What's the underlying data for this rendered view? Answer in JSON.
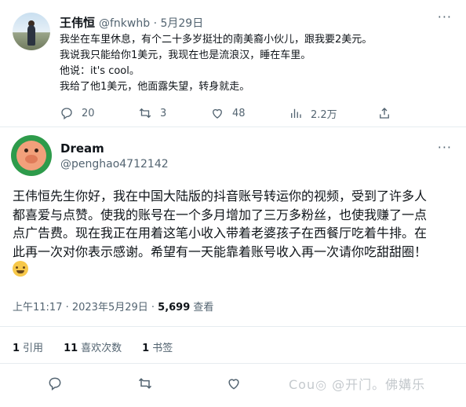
{
  "reply_tweet": {
    "author_name": "王伟恒",
    "author_handle": "@fnkwhb · 5月29日",
    "lines": [
      "我坐在车里休息，有个二十多岁挺壮的南美裔小伙儿，跟我要2美元。",
      "我说我只能给你1美元，我现在也是流浪汉，睡在车里。",
      "他说：it's cool。",
      "我给了他1美元，他面露失望，转身就走。"
    ],
    "actions": {
      "reply_count": "20",
      "retweet_count": "3",
      "like_count": "48",
      "view_count": "2.2万"
    }
  },
  "main_tweet": {
    "author_name": "Dream",
    "author_handle": "@penghao4712142",
    "lines": [
      "王伟恒先生你好，我在中国大陆版的抖音账号转运你的视频，受到了许多人",
      "都喜爱与点赞。使我的账号在一个多月增加了三万多粉丝，也使我赚了一点",
      "点广告费。现在我正在用着这笔小收入带着老婆孩子在西餐厅吃着牛排。在",
      "此再一次对你表示感谢。希望有一天能靠着账号收入再一次请你吃甜甜圈！"
    ],
    "emoji_icon": "smiling-face-with-hearts-emoji",
    "timestamp": "上午11:17 · 2023年5月29日 · ",
    "views_value": "5,699",
    "views_label": " 查看",
    "stats": {
      "retweets_value": "1",
      "retweets_label": "引用",
      "quotes_value": "11",
      "quotes_label": "喜欢次数",
      "bookmarks_value": "1",
      "bookmarks_label": "书签"
    }
  },
  "watermark": "Cou◎ @开门。佛媾乐",
  "colors": {
    "text": "#0f1419",
    "secondary": "#536471",
    "divider": "#e6ecf0"
  }
}
